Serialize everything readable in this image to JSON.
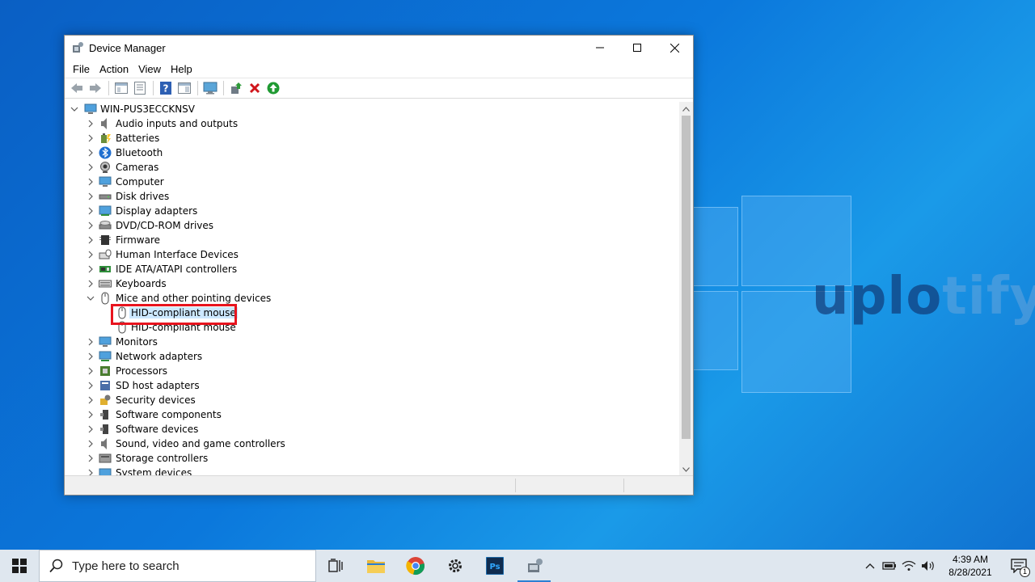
{
  "window": {
    "title": "Device Manager",
    "menu": [
      "File",
      "Action",
      "View",
      "Help"
    ]
  },
  "tree": {
    "root": "WIN-PUS3ECCKNSV",
    "categories": [
      {
        "label": "Audio inputs and outputs",
        "icon": "speaker-icon"
      },
      {
        "label": "Batteries",
        "icon": "battery-icon"
      },
      {
        "label": "Bluetooth",
        "icon": "bluetooth-icon"
      },
      {
        "label": "Cameras",
        "icon": "camera-icon"
      },
      {
        "label": "Computer",
        "icon": "computer-icon"
      },
      {
        "label": "Disk drives",
        "icon": "disk-drive-icon"
      },
      {
        "label": "Display adapters",
        "icon": "display-adapter-icon"
      },
      {
        "label": "DVD/CD-ROM drives",
        "icon": "dvd-drive-icon"
      },
      {
        "label": "Firmware",
        "icon": "firmware-icon"
      },
      {
        "label": "Human Interface Devices",
        "icon": "hid-icon"
      },
      {
        "label": "IDE ATA/ATAPI controllers",
        "icon": "ide-controller-icon"
      },
      {
        "label": "Keyboards",
        "icon": "keyboard-icon"
      },
      {
        "label": "Mice and other pointing devices",
        "icon": "mouse-icon",
        "expanded": true
      },
      {
        "label": "Monitors",
        "icon": "monitor-icon"
      },
      {
        "label": "Network adapters",
        "icon": "network-adapter-icon"
      },
      {
        "label": "Processors",
        "icon": "processor-icon"
      },
      {
        "label": "SD host adapters",
        "icon": "sd-adapter-icon"
      },
      {
        "label": "Security devices",
        "icon": "security-device-icon"
      },
      {
        "label": "Software components",
        "icon": "software-component-icon"
      },
      {
        "label": "Software devices",
        "icon": "software-device-icon"
      },
      {
        "label": "Sound, video and game controllers",
        "icon": "sound-controller-icon"
      },
      {
        "label": "Storage controllers",
        "icon": "storage-controller-icon"
      },
      {
        "label": "System devices",
        "icon": "system-device-icon"
      }
    ],
    "mice_children": [
      {
        "label": "HID-compliant mouse",
        "selected": true
      },
      {
        "label": "HID-compliant mouse",
        "selected": false
      }
    ]
  },
  "taskbar": {
    "search_placeholder": "Type here to search",
    "time": "4:39 AM",
    "date": "8/28/2021",
    "notification_count": "1"
  },
  "wallpaper": {
    "watermark_dark": "uplo",
    "watermark_light": "tify"
  },
  "colors": {
    "selection": "#cce8ff",
    "highlight_box": "#e8141e",
    "desktop": "#0b78dc"
  }
}
